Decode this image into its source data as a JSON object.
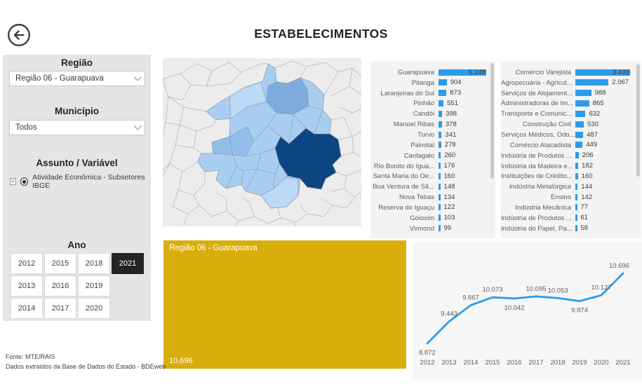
{
  "header": {
    "title": "ESTABELECIMENTOS",
    "back_icon": "arrow-left-circle"
  },
  "sidebar": {
    "regiao_label": "Região",
    "regiao_value": "Região 06 - Guarapuava",
    "municipio_label": "Município",
    "municipio_value": "Todos",
    "assunto_label": "Assunto / Variável",
    "assunto_option": "Atividade Econômica - Subsetores IBGE",
    "assunto_option_selected": true,
    "ano_label": "Ano",
    "year_grid": [
      "2012",
      "2015",
      "2018",
      "2021",
      "2013",
      "2016",
      "2019",
      "",
      "2014",
      "2017",
      "2020",
      ""
    ],
    "selected_year": "2021"
  },
  "kpi": {
    "label": "Região 06 - Guarapuava",
    "value": "10.696"
  },
  "footer": {
    "line1": "Fonte: MTE/RAIS",
    "line2": "Dados extraídos da Base de Dados do Estado - BDEweb"
  },
  "colors": {
    "accent_blue": "#2e9bea",
    "map_dark": "#0d4583",
    "map_medium": "#7facde",
    "map_light": "#a9cef1",
    "kpi_yellow": "#d9ae0c",
    "selected_year_bg": "#252423"
  },
  "chart_data": [
    {
      "type": "bar",
      "orientation": "horizontal",
      "title": "Estabelecimentos por município",
      "categories": [
        "Guarapuava",
        "Pitanga",
        "Laranjeiras do Sul",
        "Pinhão",
        "Candói",
        "Manoel Ribas",
        "Turvo",
        "Palmital",
        "Cantagalo",
        "Rio Bonito do Igua...",
        "Santa Maria do Oe...",
        "Boa Ventura de Sã...",
        "Nova Tebas",
        "Reserva do Iguaçu",
        "Goioxim",
        "Virmond"
      ],
      "values": [
        5248,
        904,
        873,
        551,
        398,
        378,
        341,
        278,
        260,
        176,
        160,
        148,
        134,
        122,
        103,
        99
      ],
      "labels": [
        "5.248",
        "904",
        "873",
        "551",
        "398",
        "378",
        "341",
        "278",
        "260",
        "176",
        "160",
        "148",
        "134",
        "122",
        "103",
        "99"
      ],
      "xlim": [
        0,
        5248
      ],
      "scrollable": true
    },
    {
      "type": "bar",
      "orientation": "horizontal",
      "title": "Estabelecimentos por subsetor IBGE",
      "categories": [
        "Comércio Varejista",
        "Agropecuária - Agricul...",
        "Serviços de Alojament...",
        "Administradoras de Im...",
        "Transporte e Comunic...",
        "Construção Civil",
        "Serviços Médicos, Odo...",
        "Comércio Atacadista",
        "Indústria de Produtos ...",
        "Indústria da Madeira e...",
        "Instituições de Crédito...",
        "Indústria Metalúrgica",
        "Ensino",
        "Indústria Mecânica",
        "Indústria de Produtos ...",
        "Indústria do Papel, Pa..."
      ],
      "values": [
        3409,
        2067,
        988,
        865,
        632,
        530,
        487,
        449,
        206,
        182,
        160,
        144,
        142,
        77,
        61,
        58
      ],
      "labels": [
        "3.409",
        "2.067",
        "988",
        "865",
        "632",
        "530",
        "487",
        "449",
        "206",
        "182",
        "160",
        "144",
        "142",
        "77",
        "61",
        "58"
      ],
      "xlim": [
        0,
        3409
      ],
      "scrollable": true
    },
    {
      "type": "line",
      "title": "Estabelecimentos por ano",
      "x": [
        "2012",
        "2013",
        "2014",
        "2015",
        "2016",
        "2017",
        "2018",
        "2019",
        "2020",
        "2021"
      ],
      "values": [
        8872,
        9443,
        9867,
        10073,
        10042,
        10095,
        10053,
        9974,
        10127,
        10696
      ],
      "labels": [
        "8.872",
        "9.443",
        "9.867",
        "10.073",
        "10.042",
        "10.095",
        "10.053",
        "9.974",
        "10.127",
        "10.696"
      ],
      "label_side": [
        "below",
        "above",
        "above",
        "above",
        "below",
        "above",
        "above",
        "below",
        "above",
        "above"
      ],
      "ylim": [
        8700,
        10800
      ],
      "grid": false,
      "legend": "none"
    }
  ]
}
